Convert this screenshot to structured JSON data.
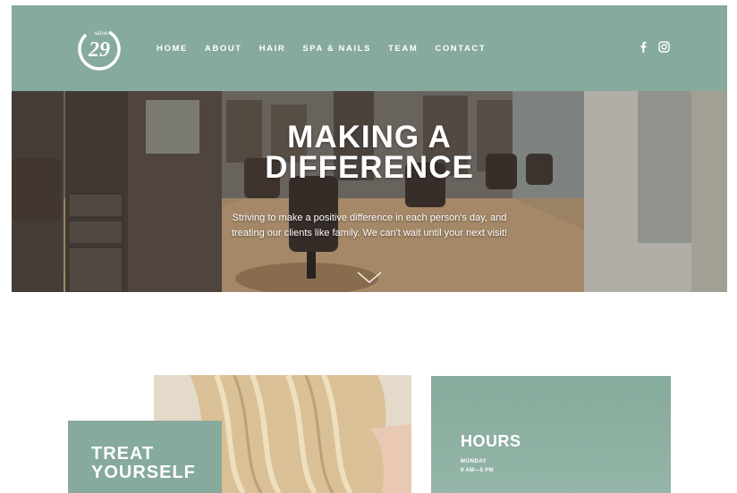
{
  "header": {
    "logo_alt": "salon 29",
    "nav": [
      {
        "label": "HOME"
      },
      {
        "label": "ABOUT"
      },
      {
        "label": "HAIR"
      },
      {
        "label": "SPA & NAILS"
      },
      {
        "label": "TEAM"
      },
      {
        "label": "CONTACT"
      }
    ],
    "social": [
      {
        "icon": "facebook-icon"
      },
      {
        "icon": "instagram-icon"
      }
    ]
  },
  "hero": {
    "title_line1": "MAKING A",
    "title_line2": "DIFFERENCE",
    "subtitle_line1": "Striving to make a positive difference in each person's day, and",
    "subtitle_line2": "treating our clients like family. We can't wait until your next visit!",
    "scroll_icon": "chevron-down-icon"
  },
  "treat": {
    "title_line1": "TREAT",
    "title_line2": "YOURSELF"
  },
  "hours": {
    "title": "HOURS",
    "day": "MONDAY",
    "time": "9 AM—5 PM"
  },
  "colors": {
    "accent": "#86aa9b",
    "white": "#ffffff"
  }
}
